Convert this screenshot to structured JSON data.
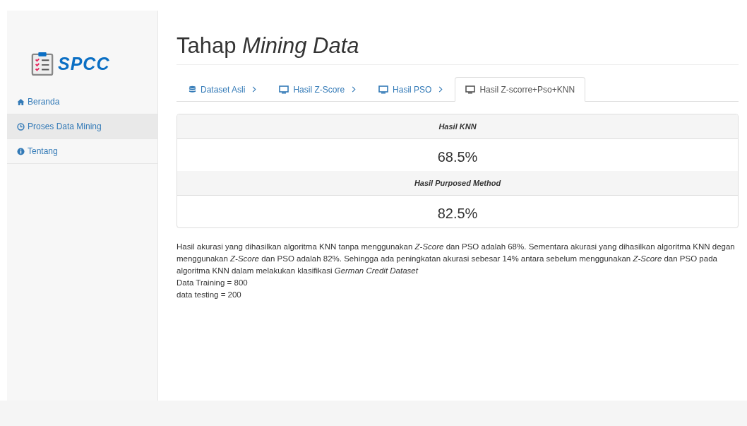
{
  "sidebar": {
    "logo_text": "SPCC",
    "items": [
      {
        "label": "Beranda",
        "kind": "home",
        "selected": false
      },
      {
        "label": "Proses Data Mining",
        "kind": "clock",
        "selected": true
      },
      {
        "label": "Tentang",
        "kind": "info",
        "selected": false
      }
    ]
  },
  "page_title": "Tahap *Mining Data*",
  "tabs": [
    {
      "label": "Dataset Asli",
      "kind": "database",
      "chevron": true,
      "selected": false
    },
    {
      "label": "Hasil Z-Score",
      "kind": "monitor",
      "chevron": true,
      "selected": false
    },
    {
      "label": "Hasil PSO",
      "kind": "monitor",
      "chevron": true,
      "selected": false
    },
    {
      "label": "Hasil Z-scorre+Pso+KNN",
      "kind": "monitor",
      "chevron": false,
      "selected": true
    }
  ],
  "results": [
    {
      "kind": "heading",
      "text": "Hasil KNN"
    },
    {
      "kind": "value",
      "text": "68.5%"
    },
    {
      "kind": "heading",
      "text": "Hasil Purposed Method"
    },
    {
      "kind": "value",
      "text": "82.5%"
    }
  ],
  "description": [
    "Hasil akurasi yang dihasilkan algoritma KNN tanpa menggunakan *Z-Score* dan PSO adalah 68%. Sementara akurasi yang dihasilkan algoritma KNN degan menggunakan *Z-Score* dan PSO adalah 82%. Sehingga ada peningkatan akurasi sebesar 14% antara sebelum menggunakan *Z-Score* dan PSO pada algoritma KNN dalam melakukan klasifikasi *German Credit Dataset*",
    "Data Training = 800",
    "data testing = 200"
  ]
}
